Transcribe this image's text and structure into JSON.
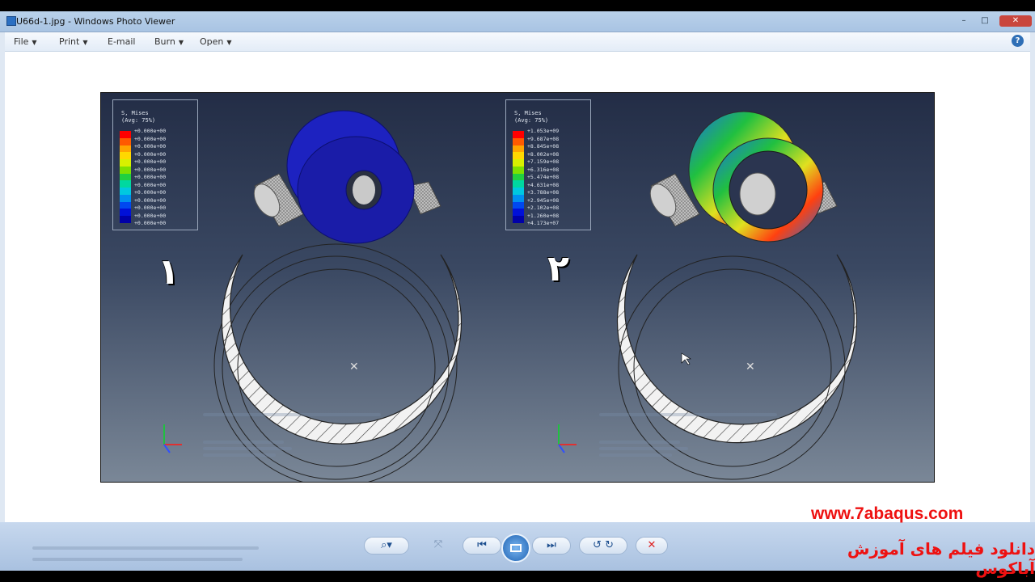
{
  "window": {
    "title": "U66d-1.jpg - Windows Photo Viewer",
    "controls": {
      "minimize": "–",
      "maximize": "□",
      "close": "✕"
    }
  },
  "menubar": {
    "items": [
      {
        "label": "File",
        "has_dropdown": true
      },
      {
        "label": "Print",
        "has_dropdown": true
      },
      {
        "label": "E-mail",
        "has_dropdown": false
      },
      {
        "label": "Burn",
        "has_dropdown": true
      },
      {
        "label": "Open",
        "has_dropdown": true
      }
    ],
    "help_label": "?"
  },
  "photo": {
    "left_panel": {
      "legend_title_1": "S, Mises",
      "legend_title_2": "(Avg: 75%)",
      "legend_values": [
        "+0.000e+00",
        "+0.000e+00",
        "+0.000e+00",
        "+0.000e+00",
        "+0.000e+00",
        "+0.000e+00",
        "+0.000e+00",
        "+0.000e+00",
        "+0.000e+00",
        "+0.000e+00",
        "+0.000e+00",
        "+0.000e+00",
        "+0.000e+00"
      ],
      "number": "١"
    },
    "right_panel": {
      "legend_title_1": "S, Mises",
      "legend_title_2": "(Avg: 75%)",
      "legend_values": [
        "+1.053e+09",
        "+9.687e+08",
        "+8.845e+08",
        "+8.002e+08",
        "+7.159e+08",
        "+6.316e+08",
        "+5.474e+08",
        "+4.631e+08",
        "+3.788e+08",
        "+2.945e+08",
        "+2.102e+08",
        "+1.260e+08",
        "+4.173e+07"
      ],
      "number": "٢"
    },
    "colors": {
      "ring_band": "#f2f2f2",
      "roller": "#b9b9b9",
      "blue_part": "#1d1fb8",
      "legend_scale": [
        "#ff0000",
        "#ff5a00",
        "#ffa500",
        "#ffd800",
        "#d8f000",
        "#7ee000",
        "#20d040",
        "#00d8a0",
        "#00c8e0",
        "#0090f0",
        "#0048f0",
        "#0010d8",
        "#0000a8"
      ]
    }
  },
  "toolbar": {
    "zoom_icon": "magnifier-icon",
    "buttons": [
      "zoom-button",
      "fit-button",
      "previous-button",
      "slideshow-button",
      "next-button",
      "rotate-ccw-button",
      "rotate-cw-button",
      "delete-button"
    ]
  },
  "watermark": {
    "url": "www.7abaqus.com",
    "persian": "دانلود فیلم های آموزش آباکوس"
  }
}
